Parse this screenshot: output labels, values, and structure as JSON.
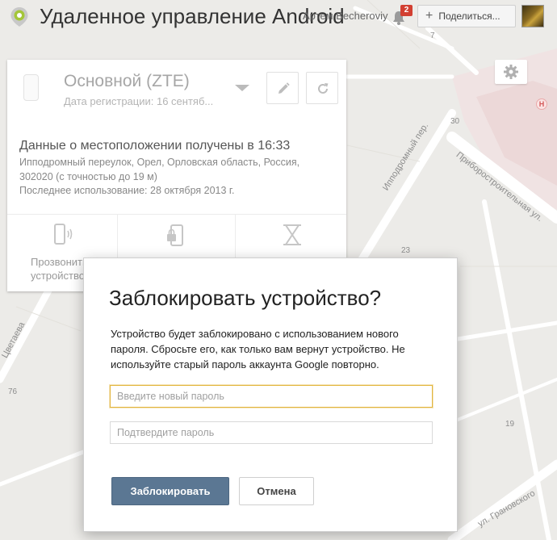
{
  "header": {
    "app_title": "Удаленное управление Android",
    "user_name": "Артем Becheroviy",
    "notification_count": "2",
    "share_label": "Поделиться..."
  },
  "device": {
    "name": "Основной (ZTE)",
    "registration": "Дата регистрации: 16 сентяб...",
    "location_title": "Данные о местоположении получены в 16:33",
    "location_address": "Ипподромный переулок, Орел, Орловская область, Россия, 302020 (с точностью до 19 м)",
    "last_used": "Последнее использование: 28 октября 2013 г.",
    "actions": [
      {
        "label": "Прозвонить устройство"
      },
      {
        "label": ""
      },
      {
        "label": ""
      }
    ]
  },
  "map": {
    "streets": [
      "Ипподромный пер.",
      "Приборостроительная ул.",
      "ул. Грановского",
      "Цветаева"
    ],
    "numbers": [
      "7",
      "30",
      "23",
      "76",
      "19"
    ],
    "hospital_marker": "H"
  },
  "dialog": {
    "title": "Заблокировать устройство?",
    "description": "Устройство будет заблокировано с использованием нового пароля. Сбросьте его, как только вам вернут устройство. Не используйте старый пароль аккаунта Google повторно.",
    "new_password_placeholder": "Введите новый пароль",
    "confirm_password_placeholder": "Подтвердите пароль",
    "lock_button": "Заблокировать",
    "cancel_button": "Отмена"
  }
}
